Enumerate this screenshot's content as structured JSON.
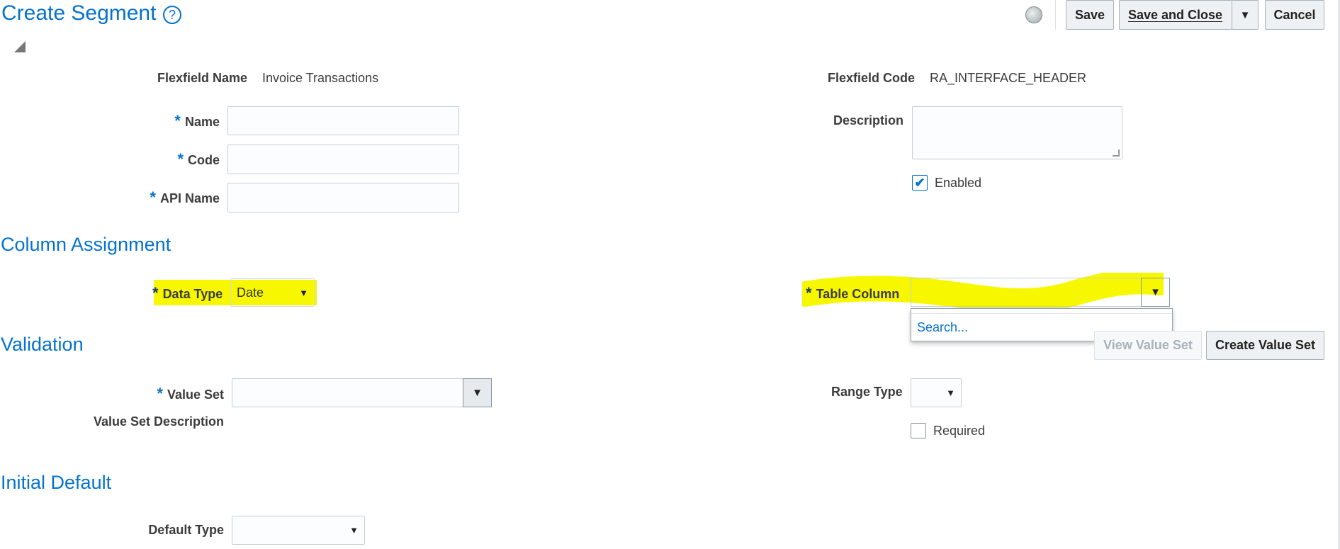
{
  "header": {
    "title": "Create Segment",
    "help_icon": "question-circle-icon",
    "diagnostics_icon": "diagnostics-icon",
    "save_label": "Save",
    "save_close_label": "Save and Close",
    "cancel_label": "Cancel"
  },
  "flexfield": {
    "name_label": "Flexfield Name",
    "name_value": "Invoice Transactions",
    "code_label": "Flexfield Code",
    "code_value": "RA_INTERFACE_HEADER"
  },
  "fields": {
    "required_mark": "*",
    "name_label": "Name",
    "code_label": "Code",
    "api_name_label": "API Name",
    "description_label": "Description",
    "enabled_label": "Enabled"
  },
  "column_assignment": {
    "heading": "Column Assignment",
    "data_type_label": "Data Type",
    "data_type_value": "Date",
    "table_column_label": "Table Column",
    "search_option": "Search..."
  },
  "validation": {
    "heading": "Validation",
    "view_value_set_label": "View Value Set",
    "create_value_set_label": "Create Value Set",
    "value_set_label": "Value Set",
    "value_set_description_label": "Value Set Description",
    "range_type_label": "Range Type",
    "required_label": "Required"
  },
  "initial_default": {
    "heading": "Initial Default",
    "default_type_label": "Default Type"
  },
  "colors": {
    "accent": "#0572CE",
    "highlight": "#f7f700"
  }
}
